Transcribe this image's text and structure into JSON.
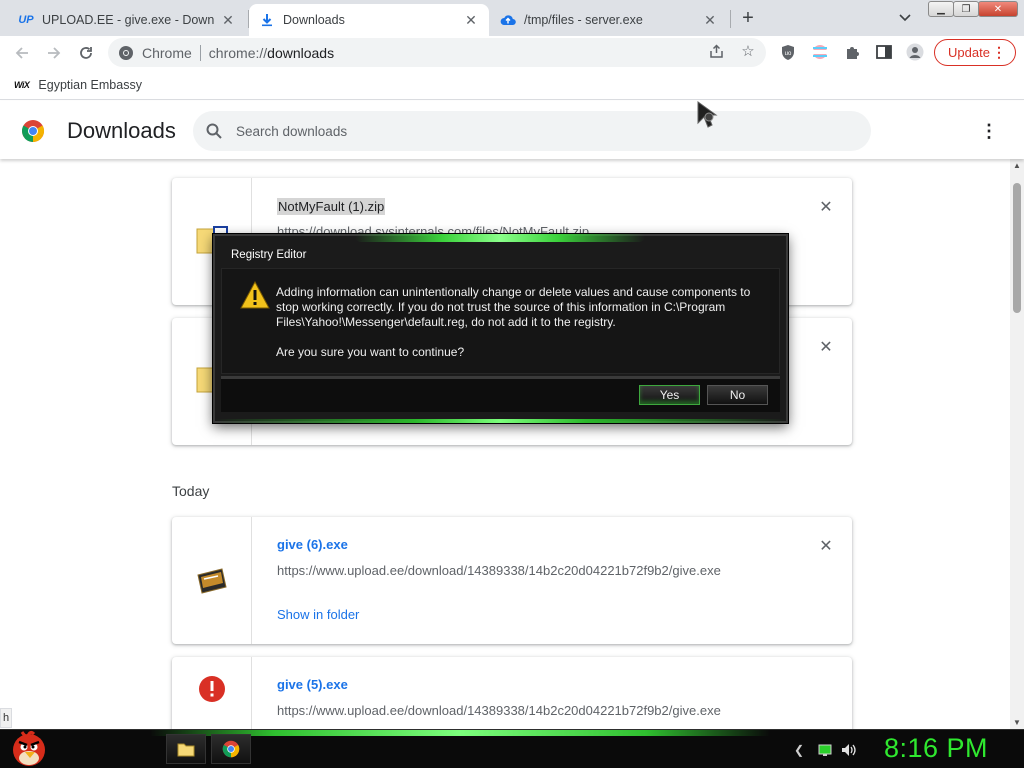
{
  "tabs": [
    {
      "favicon_text": "UP",
      "title": "UPLOAD.EE - give.exe - Downloa",
      "active": false
    },
    {
      "favicon_text": "",
      "title": "Downloads",
      "active": true
    },
    {
      "favicon_text": "",
      "title": "/tmp/files - server.exe",
      "active": false
    }
  ],
  "omnibox": {
    "site_name": "Chrome",
    "url_scheme": "chrome://",
    "url_path": "downloads"
  },
  "toolbar": {
    "update_label": "Update"
  },
  "bookmarks": [
    {
      "icon_text": "WiX",
      "label": "Egyptian Embassy"
    }
  ],
  "downloads_page": {
    "title": "Downloads",
    "search_placeholder": "Search downloads",
    "section_today": "Today",
    "items": [
      {
        "name": "NotMyFault (1).zip",
        "url": "https://download.sysinternals.com/files/NotMyFault.zip",
        "action": ""
      },
      {
        "name": "",
        "url": "",
        "action": ""
      },
      {
        "name": "give (6).exe",
        "url": "https://www.upload.ee/download/14389338/14b2c20d04221b72f9b2/give.exe",
        "action": "Show in folder"
      },
      {
        "name": "give (5).exe",
        "url": "https://www.upload.ee/download/14389338/14b2c20d04221b72f9b2/give.exe",
        "action": ""
      }
    ]
  },
  "dialog": {
    "title": "Registry Editor",
    "message": "Adding information can unintentionally change or delete values and cause components to stop working correctly. If you do not trust the source of this information in C:\\Program Files\\Yahoo!\\Messenger\\default.reg, do not add it to the registry.",
    "question": "Are you sure you want to continue?",
    "yes_label": "Yes",
    "no_label": "No"
  },
  "statusbar": {
    "text": "h"
  },
  "taskbar": {
    "clock": "8:16 PM"
  },
  "colors": {
    "accent_link": "#1a73e8",
    "update_red": "#d93025",
    "clock_green": "#2fe82f",
    "dialog_bg": "#1b1b1b"
  }
}
